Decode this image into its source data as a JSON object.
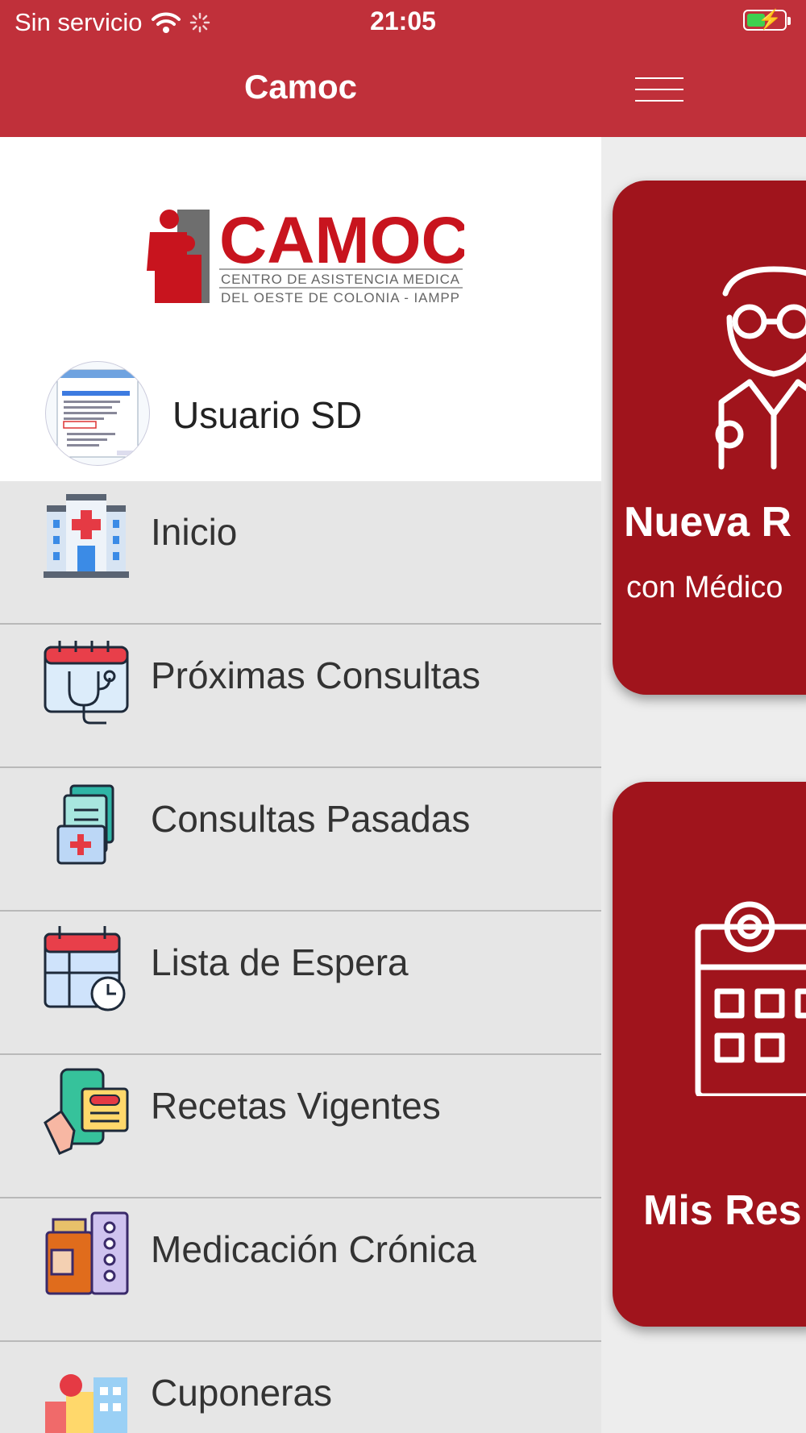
{
  "status_bar": {
    "carrier": "Sin servicio",
    "time": "21:05",
    "icons": [
      "wifi-icon",
      "activity-spinner-icon",
      "battery-charging-icon"
    ]
  },
  "header": {
    "title": "Camoc",
    "menu_icon": "hamburger-icon"
  },
  "drawer": {
    "logo": {
      "name": "CAMOC",
      "line1": "CENTRO DE ASISTENCIA MEDICA",
      "line2": "DEL OESTE DE COLONIA - IAMPP"
    },
    "user": {
      "name": "Usuario SD"
    },
    "items": [
      {
        "label": "Inicio",
        "icon": "hospital-icon"
      },
      {
        "label": "Próximas Consultas",
        "icon": "calendar-stethoscope-icon"
      },
      {
        "label": "Consultas Pasadas",
        "icon": "medical-folder-icon"
      },
      {
        "label": "Lista de Espera",
        "icon": "calendar-clock-icon"
      },
      {
        "label": "Recetas Vigentes",
        "icon": "phone-prescription-icon"
      },
      {
        "label": "Medicación Crónica",
        "icon": "medicine-bottle-icon"
      },
      {
        "label": "Cuponeras",
        "icon": "coupons-icon"
      }
    ]
  },
  "main": {
    "cards": [
      {
        "title": "Nueva R",
        "subtitle": "con Médico",
        "icon": "doctor-icon"
      },
      {
        "title": "Mis Res",
        "icon": "calendar-icon"
      }
    ]
  },
  "colors": {
    "brand": "#c0303a",
    "card": "#a0141c",
    "drawer_bg": "#e6e6e6"
  }
}
